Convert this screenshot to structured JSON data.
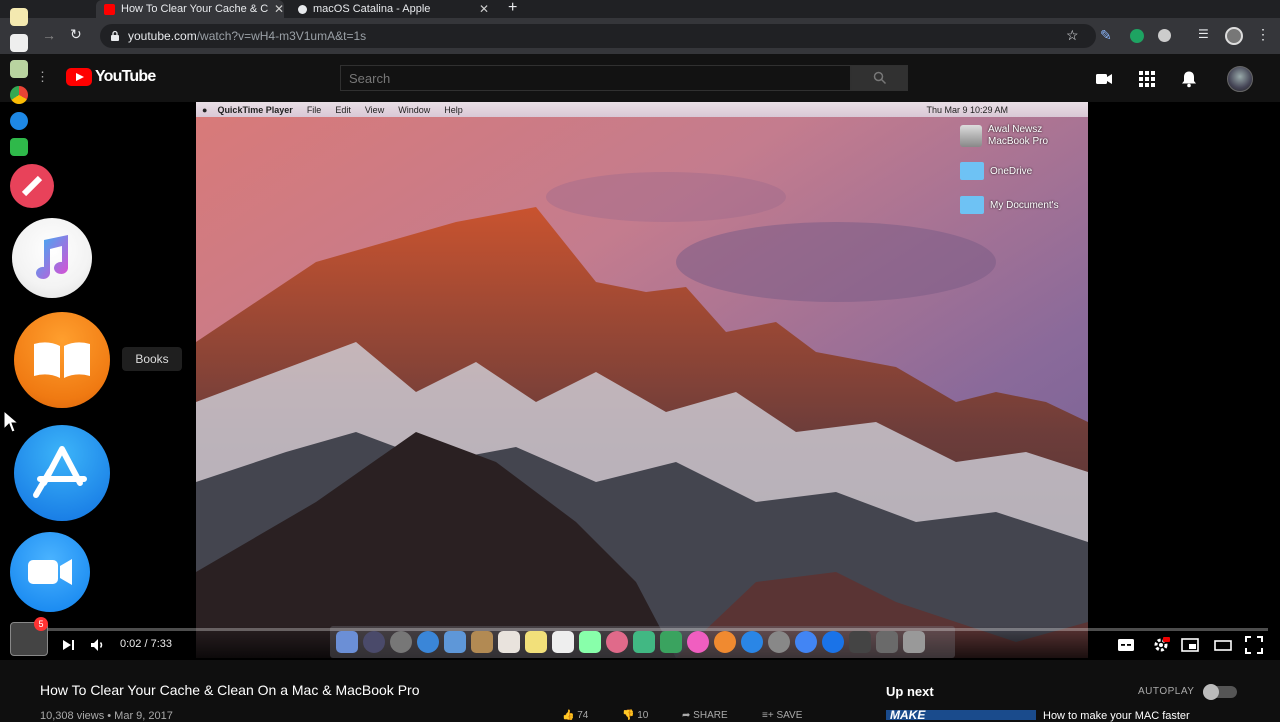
{
  "browser": {
    "tabs": [
      {
        "title": "How To Clear Your Cache & Clean",
        "active": true,
        "favicon_color": "#ff0000"
      },
      {
        "title": "macOS Catalina - Apple",
        "active": false,
        "favicon_color": "#e8eaed"
      }
    ],
    "url_host": "youtube.com",
    "url_path": "/watch?v=wH4-m3V1umA&t=1s"
  },
  "youtube": {
    "logo_text": "YouTube",
    "search_placeholder": "Search"
  },
  "tooltip": {
    "label": "Books"
  },
  "video": {
    "mac_menubar": {
      "app": "QuickTime Player",
      "menus": [
        "File",
        "Edit",
        "View",
        "Window",
        "Help"
      ],
      "clock": "Thu Mar 9  10:29 AM"
    },
    "desktop_items": [
      {
        "label": "Awal Newsz MacBook Pro",
        "type": "disk"
      },
      {
        "label": "OneDrive",
        "type": "folder"
      },
      {
        "label": "My Document's",
        "type": "folder"
      }
    ],
    "time_current": "0:02",
    "time_total": "7:33",
    "time_display": "0:02 / 7:33",
    "progress": 0.004
  },
  "below": {
    "title": "How To Clear Your Cache & Clean On a Mac & MacBook Pro",
    "meta": "10,308 views • Mar 9, 2017",
    "up_next": "Up next",
    "autoplay": "AUTOPLAY",
    "next_thumb_text": "MAKE",
    "next_title": "How to make your MAC faster",
    "likes": "74",
    "dislikes": "10",
    "share": "SHARE",
    "save": "SAVE"
  },
  "dock_badge": "5",
  "colors": {
    "accent": "#ff0000",
    "background": "#0f0f0f"
  }
}
